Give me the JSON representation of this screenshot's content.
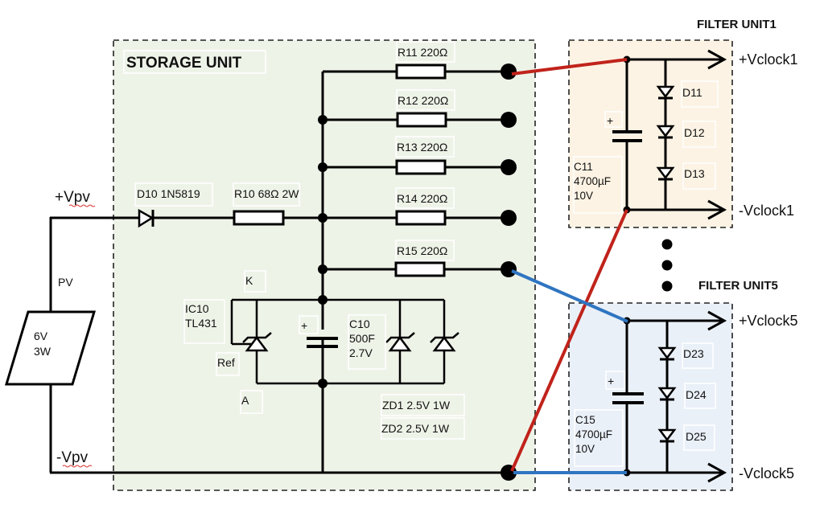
{
  "storage_unit": {
    "title": "STORAGE UNIT",
    "background": "#eef3e8",
    "input": {
      "pos_label": "+Vpv",
      "neg_label": "-Vpv",
      "source_label": "PV",
      "source_rating_line1": "6V",
      "source_rating_line2": "3W"
    },
    "diode": {
      "label": "D10 1N5819"
    },
    "series_resistor": {
      "label": "R10 68Ω 2W"
    },
    "output_resistors": [
      {
        "label": "R11 220Ω"
      },
      {
        "label": "R12 220Ω"
      },
      {
        "label": "R13 220Ω"
      },
      {
        "label": "R14 220Ω"
      },
      {
        "label": "R15 220Ω"
      }
    ],
    "shunt_regulator": {
      "label_line1": "IC10",
      "label_line2": "TL431",
      "pin_k": "K",
      "pin_a": "A",
      "pin_ref": "Ref"
    },
    "supercap": {
      "polarity": "+",
      "label_line1": "C10",
      "label_line2": "500F",
      "label_line3": "2.7V"
    },
    "zener_labels": [
      "ZD1 2.5V 1W",
      "ZD2 2.5V 1W"
    ]
  },
  "filter_units": [
    {
      "title": "FILTER UNIT1",
      "background": "#fcf3e4",
      "wire_color": "#c0231b",
      "pos_rail": "+Vclock1",
      "neg_rail": "-Vclock1",
      "cap_polarity": "+",
      "cap_line1": "C11",
      "cap_line2": "4700µF",
      "cap_line3": "10V",
      "diodes": [
        "D11",
        "D12",
        "D13"
      ]
    },
    {
      "title": "FILTER UNIT5",
      "background": "#eaf0f8",
      "wire_color": "#2f75c1",
      "pos_rail": "+Vclock5",
      "neg_rail": "-Vclock5",
      "cap_polarity": "+",
      "cap_line1": "C15",
      "cap_line2": "4700µF",
      "cap_line3": "10V",
      "diodes": [
        "D23",
        "D24",
        "D25"
      ]
    }
  ],
  "ellipsis_icon": "vertical-ellipsis"
}
